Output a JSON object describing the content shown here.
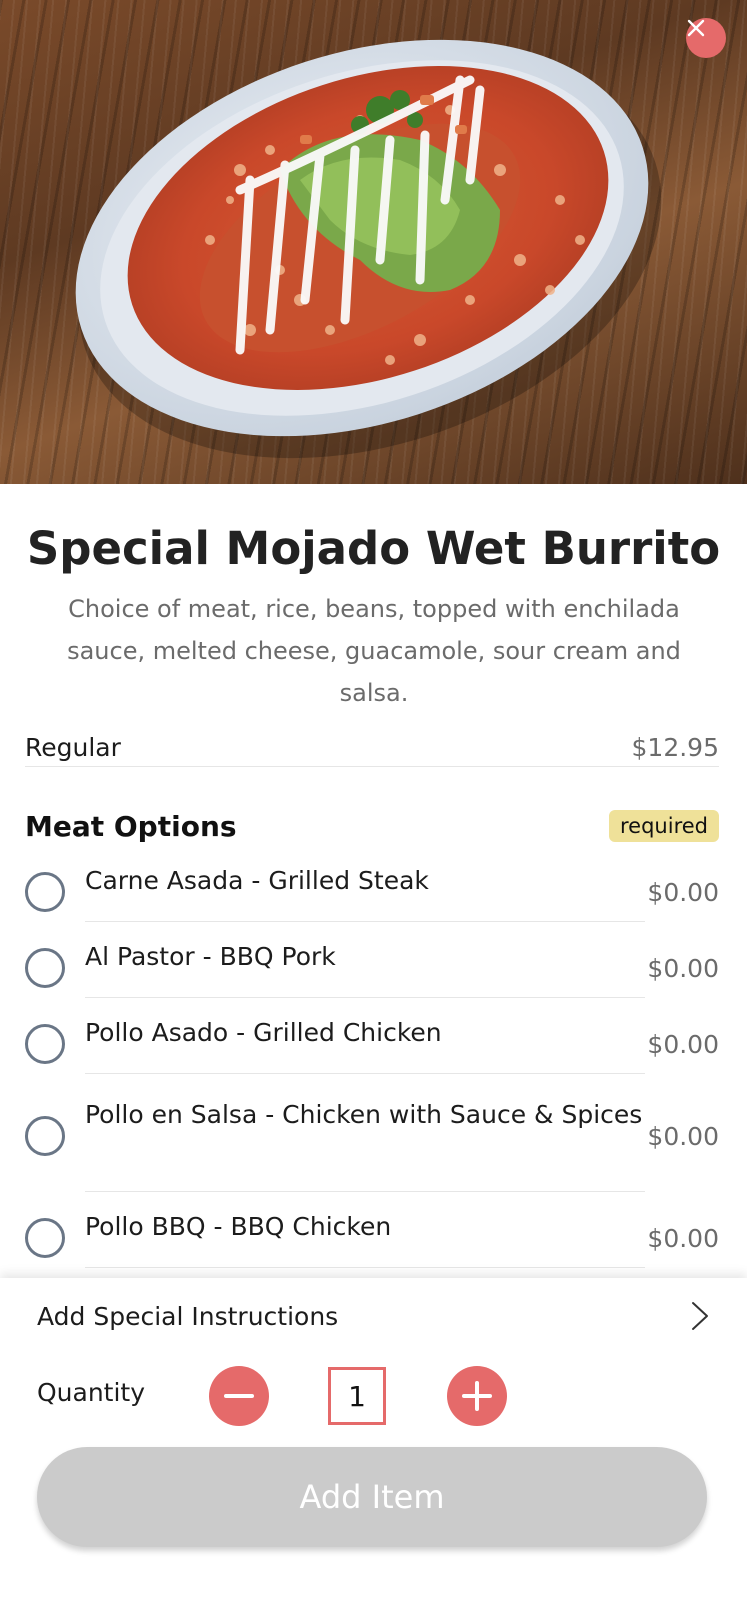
{
  "item": {
    "title": "Special Mojado Wet Burrito",
    "description": "Choice of meat, rice, beans, topped with enchilada sauce, melted cheese, guacamole, sour cream and salsa."
  },
  "size": {
    "label": "Regular",
    "price": "$12.95"
  },
  "meat_options": {
    "title": "Meat Options",
    "badge": "required",
    "items": [
      {
        "label": "Carne Asada - Grilled Steak",
        "price": "$0.00"
      },
      {
        "label": "Al Pastor - BBQ Pork",
        "price": "$0.00"
      },
      {
        "label": "Pollo Asado - Grilled Chicken",
        "price": "$0.00"
      },
      {
        "label": "Pollo en Salsa - Chicken with Sauce & Spices",
        "price": "$0.00"
      },
      {
        "label": "Pollo BBQ - BBQ Chicken",
        "price": "$0.00"
      }
    ]
  },
  "footer": {
    "instructions_label": "Add Special Instructions",
    "quantity_label": "Quantity",
    "quantity_value": "1",
    "add_button_label": "Add Item"
  },
  "colors": {
    "accent": "#e56a6a",
    "badge_bg": "#efe199",
    "disabled_button": "#cbcbcb",
    "radio_border": "#6a7686"
  },
  "icons": {
    "close": "close-icon",
    "chevron": "chevron-right-icon",
    "minus": "minus-icon",
    "plus": "plus-icon"
  }
}
